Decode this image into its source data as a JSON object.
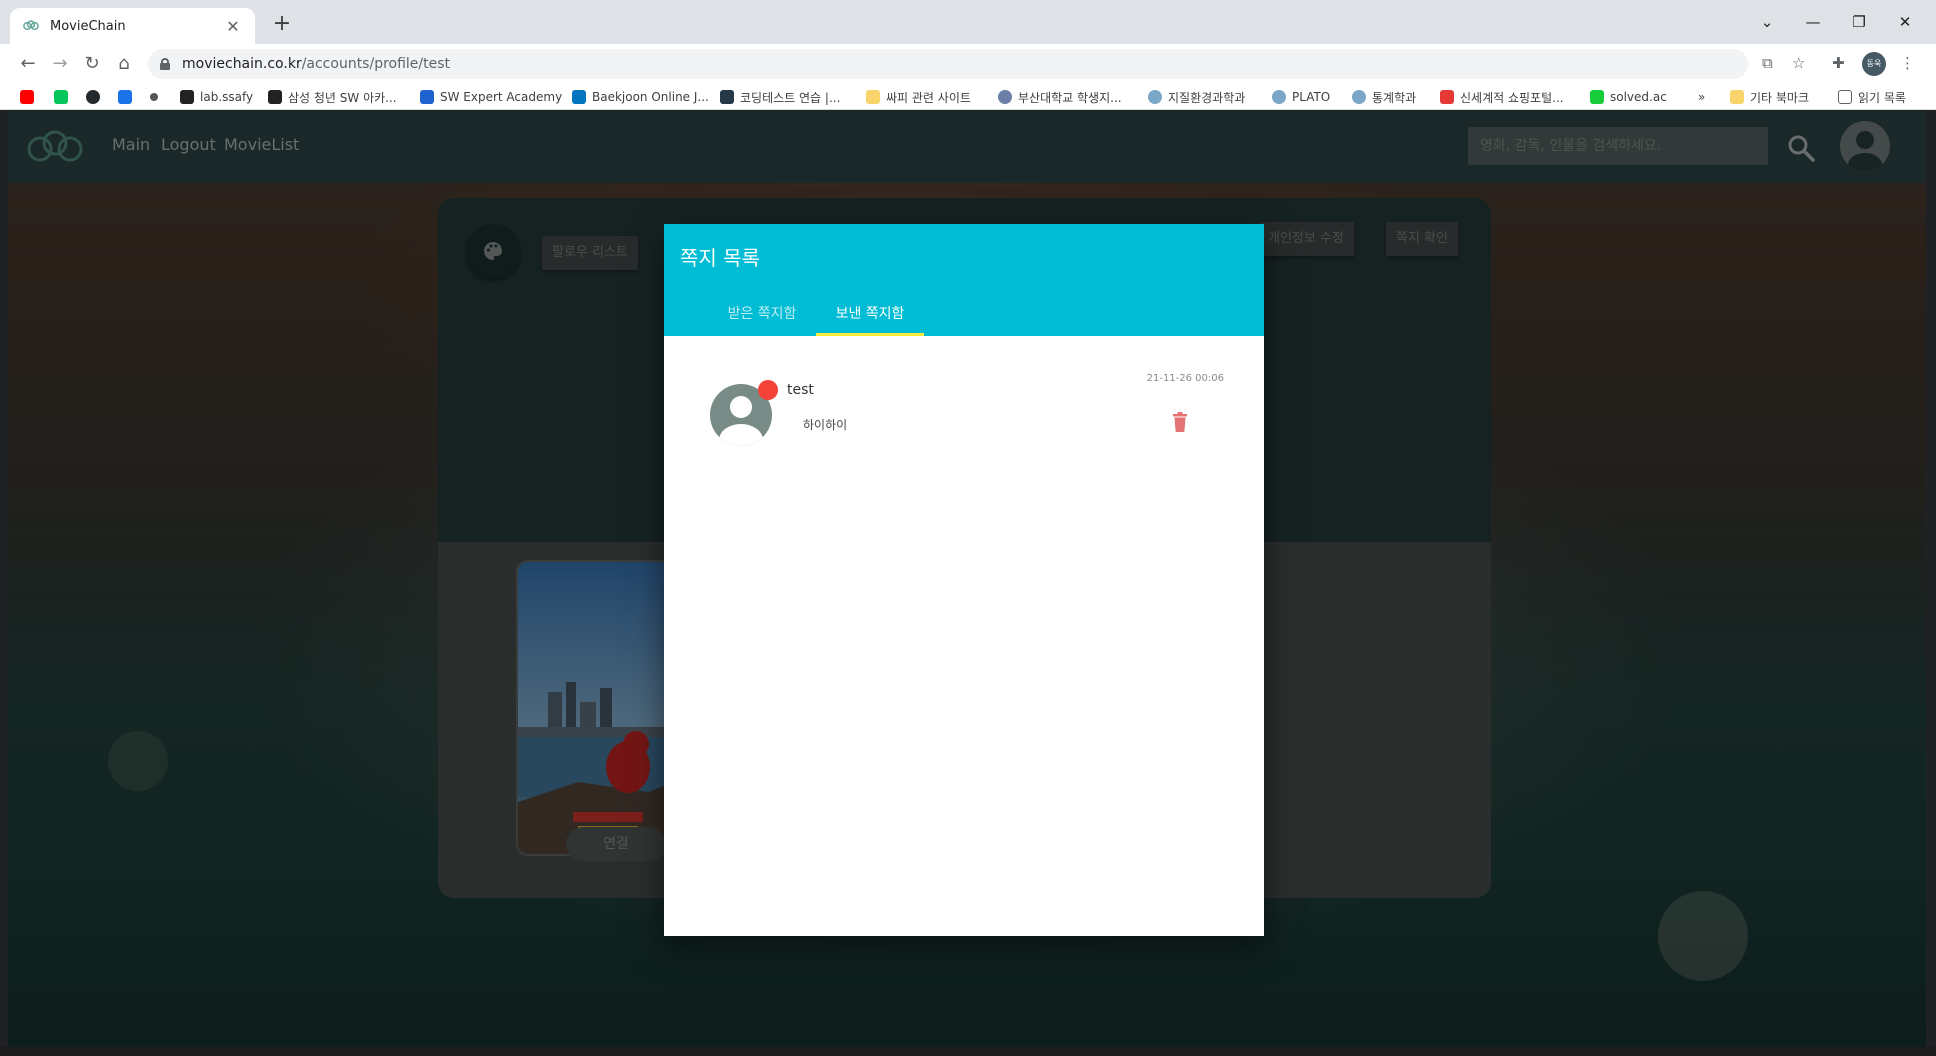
{
  "browser": {
    "tab_title": "MovieChain",
    "url_host": "moviechain.co.kr",
    "url_path": "/accounts/profile/test",
    "profile_label": "동욱",
    "bookmarks": [
      {
        "label": "",
        "color": "#ff0000"
      },
      {
        "label": "",
        "color": "#03c75a"
      },
      {
        "label": "",
        "color": "#24292e"
      },
      {
        "label": "",
        "color": "#1a73e8"
      },
      {
        "label": "",
        "color": "#333333"
      },
      {
        "label": "lab.ssafy",
        "color": "#222222"
      },
      {
        "label": "삼성 청년 SW 아카...",
        "color": "#222222"
      },
      {
        "label": "SW Expert Academy",
        "color": "#1e62d0"
      },
      {
        "label": "Baekjoon Online J...",
        "color": "#0076c0"
      },
      {
        "label": "코딩테스트 연습 |...",
        "color": "#263747"
      },
      {
        "label": "싸피 관련 사이트",
        "color": "#f9d46b"
      },
      {
        "label": "부산대학교 학생지...",
        "color": "#6b7fa8"
      },
      {
        "label": "지질환경과학과",
        "color": "#7aa6c8"
      },
      {
        "label": "PLATO",
        "color": "#7aa6c8"
      },
      {
        "label": "통계학과",
        "color": "#7aa6c8"
      },
      {
        "label": "신세계적 쇼핑포털...",
        "color": "#e53935"
      },
      {
        "label": "solved.ac",
        "color": "#17ce3a"
      }
    ],
    "bookmarks_more": "»",
    "other_bookmarks": "기타 북마크",
    "reading_list": "읽기 목록"
  },
  "site": {
    "nav": {
      "links": [
        "Main",
        "Logout",
        "MovieList"
      ],
      "search_placeholder": "영화, 감독, 인물을 검색하세요."
    },
    "profile": {
      "follow_list_label": "팔로우 리스트",
      "edit_profile_label": "개인정보 수정",
      "check_messages_label": "쪽지 확인",
      "connect_label": "연결"
    },
    "modal": {
      "title": "쪽지 목록",
      "tabs": [
        "받은 쪽지함",
        "보낸 쪽지함"
      ],
      "active_tab": "보낸 쪽지함",
      "messages": [
        {
          "sender": "test",
          "time": "21-11-26 00:06",
          "content": "하이하이"
        }
      ]
    }
  },
  "colors": {
    "accent": "#00bcd4",
    "tab_indicator": "#ffeb3b",
    "unread_dot": "#f44336",
    "delete_icon": "#e57373",
    "nav_bg": "#314b4c"
  }
}
